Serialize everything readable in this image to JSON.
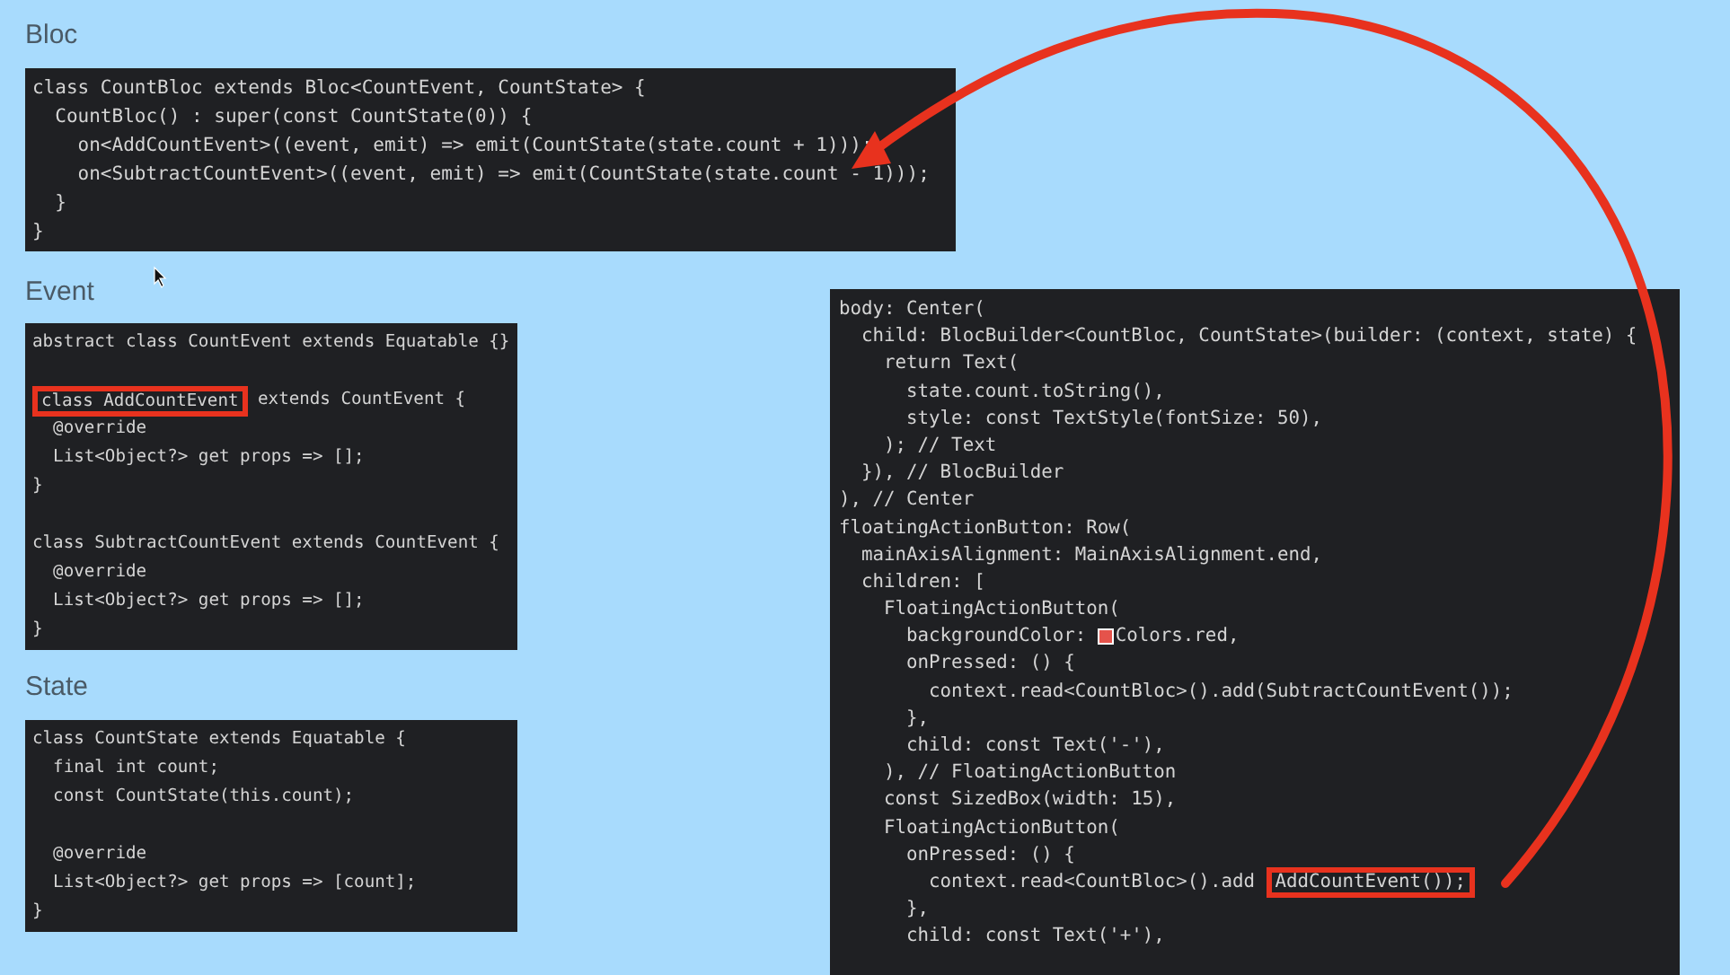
{
  "sections": [
    {
      "heading": "Bloc",
      "code": [
        "class CountBloc extends Bloc<CountEvent, CountState> {",
        "  CountBloc() : super(const CountState(0)) {",
        "    on<AddCountEvent>((event, emit) => emit(CountState(state.count + 1)));",
        "    on<SubtractCountEvent>((event, emit) => emit(CountState(state.count - 1)));",
        "  }",
        "}"
      ]
    },
    {
      "heading": "Event",
      "code": [
        "abstract class CountEvent extends Equatable {}",
        {
          "kind": "blank"
        },
        {
          "parts": [
            {
              "text": "class AddCountEvent",
              "highlighted": true
            },
            {
              "text": " extends CountEvent {",
              "highlighted": false
            }
          ]
        },
        "  @override",
        "  List<Object?> get props => [];",
        "}",
        {
          "kind": "blank"
        },
        "class SubtractCountEvent extends CountEvent {",
        "  @override",
        "  List<Object?> get props => [];",
        "}"
      ]
    },
    {
      "heading": "State",
      "code": [
        "class CountState extends Equatable {",
        "  final int count;",
        "  const CountState(this.count);",
        {
          "kind": "blank"
        },
        "  @override",
        "  List<Object?> get props => [count];",
        "}"
      ]
    }
  ],
  "widget_code": [
    "body: Center(",
    "  child: BlocBuilder<CountBloc, CountState>(builder: (context, state) {",
    "    return Text(",
    "      state.count.toString(),",
    "      style: const TextStyle(fontSize: 50),",
    "    ); // Text",
    "  }), // BlocBuilder",
    "), // Center",
    "floatingActionButton: Row(",
    "  mainAxisAlignment: MainAxisAlignment.end,",
    "  children: [",
    "    FloatingActionButton(",
    {
      "parts": [
        {
          "text": "      backgroundColor: ",
          "highlighted": false
        },
        {
          "kind": "swatch",
          "color": "#e5534b"
        },
        {
          "text": "Colors.red,",
          "highlighted": false
        }
      ]
    },
    "      onPressed: () {",
    "        context.read<CountBloc>().add(SubtractCountEvent());",
    "      },",
    "      child: const Text('-'),",
    "    ), // FloatingActionButton",
    "    const SizedBox(width: 15),",
    "    FloatingActionButton(",
    "      onPressed: () {",
    {
      "parts": [
        {
          "text": "        context.read<CountBloc>().add ",
          "highlighted": false
        },
        {
          "text": "AddCountEvent());",
          "highlighted": true
        }
      ]
    },
    "      },",
    "      child: const Text('+'),"
  ]
}
